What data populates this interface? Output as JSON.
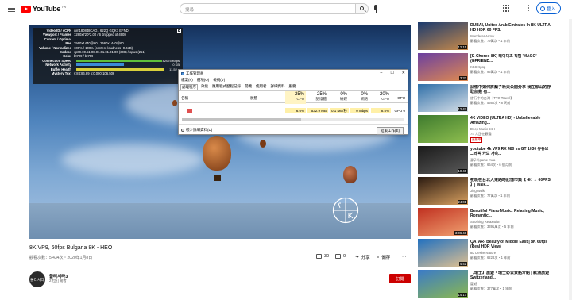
{
  "header": {
    "logo_text": "YouTube",
    "logo_region": "TW",
    "search_placeholder": "搜尋",
    "signin_label": "登入"
  },
  "stats": {
    "rows": [
      {
        "k": "Video ID / sCPN",
        "v": "wm180848CAG / 622Q GQK7 EFND"
      },
      {
        "k": "Viewport / Frames",
        "v": "1280x720*2.00 / 6 dropped of 4908"
      },
      {
        "k": "Current / Optimal",
        "v": ""
      },
      {
        "k": "Res",
        "v": "2560x1440@60 / 2560x1440@60"
      },
      {
        "k": "Volume / Normalized",
        "v": "100% / 100% (content loudness -0.0dB)"
      },
      {
        "k": "Codecs",
        "v": "vp09.00.51.08.01.01.01.01.00 (308) / opus (251)"
      },
      {
        "k": "Color",
        "v": "bt709 / bt709"
      },
      {
        "k": "Connection Speed",
        "v": ""
      },
      {
        "k": "Network Activity",
        "v": ""
      },
      {
        "k": "Buffer Health",
        "v": ""
      },
      {
        "k": "Mystery Text",
        "v": "s:8 t:86.89 b:0.000-106.506"
      }
    ],
    "connection_speed": "82075 Kbps",
    "network_activity": "0 KB",
    "buffer_health": "11.52 s",
    "close_label": "[X]"
  },
  "task_manager": {
    "title": "工作管理員",
    "window_buttons": [
      "–",
      "☐",
      "✕"
    ],
    "menu": [
      "檔案(F)",
      "選項(O)",
      "檢視(V)"
    ],
    "tabs": [
      "處理程序",
      "效能",
      "應用程式歷程記錄",
      "開機",
      "使用者",
      "詳細資料",
      "服務"
    ],
    "columns": [
      {
        "name": "名稱",
        "percent": "",
        "label": ""
      },
      {
        "name": "狀態",
        "percent": "",
        "label": ""
      },
      {
        "name": "CPU",
        "percent": "25%",
        "label": "CPU"
      },
      {
        "name": "記憶體",
        "percent": "25%",
        "label": "記憶體"
      },
      {
        "name": "磁碟",
        "percent": "0%",
        "label": "磁碟"
      },
      {
        "name": "網路",
        "percent": "0%",
        "label": "網路"
      },
      {
        "name": "GPU",
        "percent": "20%",
        "label": "GPU"
      },
      {
        "name": "GPU 引擎",
        "percent": "",
        "label": "GPU"
      }
    ],
    "row": {
      "cpu": "6.6%",
      "memory": "532.9 MB",
      "disk": "0.1 MB/秒",
      "network": "0 Mbps",
      "gpu": "8.5%",
      "gpu_engine": "GPU 0"
    },
    "fewer_details": "較少詳細資料(D)",
    "end_task": "結束工作(E)"
  },
  "video": {
    "title": "8K VP9, 60fps Bulgaria 8K - HEO",
    "meta": "觀看次數：5,434次・2020年1月8日",
    "likes": "30",
    "dislikes": "0",
    "share": "分享",
    "save": "儲存",
    "more": "…"
  },
  "channel": {
    "avatar_text": "물러서라",
    "name": "물러서라3",
    "subs": "2 位訂閱者",
    "subscribe": "訂閱"
  },
  "sidebar": [
    {
      "title": "DUBAI, United Arab Emirates In 8K ULTRA HD HDR 60 FPS.",
      "channel": "Wanderer Arrow",
      "views": "觀看次數：79萬次・1 年前",
      "duration": "12:15",
      "live": "",
      "colors": [
        "#1b3a6e",
        "#c88a4a"
      ]
    },
    {
      "title": "[K-Choreo 8K] 레이디즈 직캠 'MAGO' (GFRIEND...",
      "channel": "KBS Kpop",
      "views": "觀看次數：95萬次・1 年前",
      "duration": "3:32",
      "live": "",
      "colors": [
        "#6a3fa0",
        "#e08a50"
      ]
    },
    {
      "title": "記憶中如何將蘭子新天公開分享 我在那山的存取前幾 有...",
      "channel": "旅行中的台灣【TTG Travel】",
      "views": "觀看次數：5560次・8 天前",
      "duration": "12:47",
      "live": "",
      "colors": [
        "#2f6fa8",
        "#d8e0e8"
      ]
    },
    {
      "title": "4K VIDEO (ULTRA HD) - Unbelievable Amazing...",
      "channel": "Deep Music 24H",
      "views": "74 人正在觀看",
      "duration": "",
      "live": "直播中",
      "colors": [
        "#3e7a2e",
        "#8fbf4f"
      ]
    },
    {
      "title": "youtube 4k VP9 RX 480 vs GT 1030 유튜브 그래픽 카드 가속...",
      "channel": "플무이game mua",
      "views": "觀看次數：664次・6 個月前",
      "duration": "10:45",
      "live": "",
      "colors": [
        "#1a1a1a",
        "#5a5a5a"
      ]
    },
    {
      "title": "夜晚在台北大東路時記憶市集【 4K → 60FPS 】| Walk...",
      "channel": "Jing Walk",
      "views": "觀看次數：77萬次・1 年前",
      "duration": "24:01",
      "live": "",
      "colors": [
        "#2a1a10",
        "#d8a060"
      ]
    },
    {
      "title": "Beautiful Piano Music: Relaxing Music, Romantic...",
      "channel": "Soothing Relaxation",
      "views": "觀看次數：3391萬次・5 年前",
      "duration": "3:06:46",
      "live": "",
      "colors": [
        "#c03020",
        "#f0a070"
      ]
    },
    {
      "title": "QATAR- Beauty of Middle East | 8K 60fps (Real HDR View)",
      "channel": "8K Desire Nature",
      "views": "觀看次數：6228次・1 年前",
      "duration": "4:41",
      "live": "",
      "colors": [
        "#2070c0",
        "#e0c090"
      ]
    },
    {
      "title": "【瑞士】旅遊・瑞士必去景點介紹 | 歐洲旅遊 | Switzerland...",
      "channel": "蕾遊",
      "views": "觀看次數：377萬次・1 年前",
      "duration": "14:17",
      "live": "",
      "colors": [
        "#3a7ac8",
        "#8ab850"
      ]
    }
  ]
}
